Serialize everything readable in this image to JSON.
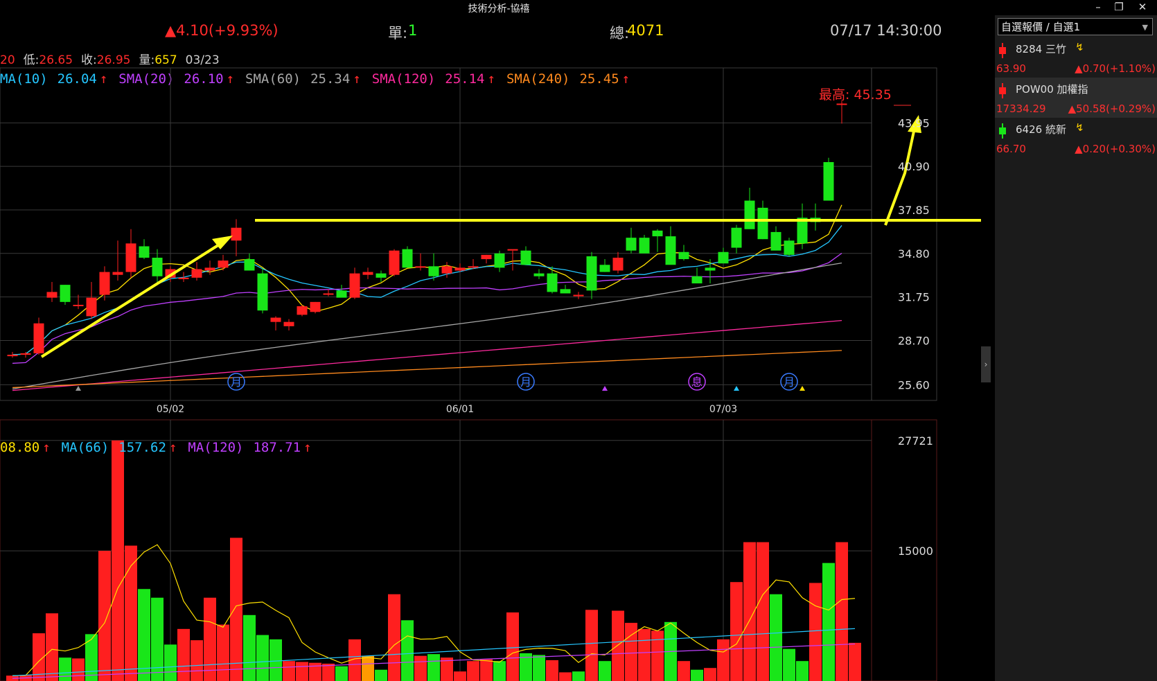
{
  "window": {
    "title": "技術分析-協禧",
    "minimize_icon": "minimize-icon",
    "restore_icon": "restore-icon",
    "close_icon": "close-icon"
  },
  "quote": {
    "change": "▲4.10(+9.93%)",
    "single_label": "單:",
    "single_value": "1",
    "total_label": "總:",
    "total_value": "4071",
    "datetime": "07/17 14:30:00"
  },
  "ohlc": {
    "high_fragment": "20",
    "low_label": "低:",
    "low_value": "26.65",
    "close_label": "收:",
    "close_value": "26.95",
    "volume_label": "量:",
    "volume_value": "657",
    "date": "03/23"
  },
  "price_ma": [
    {
      "label": "MA(10)",
      "value": "26.04",
      "arrow": "↑",
      "color": "#25c6ff"
    },
    {
      "label": "SMA(20)",
      "value": "26.10",
      "arrow": "↑",
      "color": "#c040ff"
    },
    {
      "label": "SMA(60)",
      "value": "25.34",
      "arrow": "↑",
      "color": "#a8a8a8"
    },
    {
      "label": "SMA(120)",
      "value": "25.14",
      "arrow": "↑",
      "color": "#ff2a9e"
    },
    {
      "label": "SMA(240)",
      "value": "25.45",
      "arrow": "↑",
      "color": "#ff8a1e"
    }
  ],
  "volume_ma": [
    {
      "label": "08.80",
      "value": "",
      "arrow": "↑",
      "color": "#ffe000"
    },
    {
      "label": "MA(66)",
      "value": "157.62",
      "arrow": "↑",
      "color": "#25c6ff"
    },
    {
      "label": "MA(120)",
      "value": "187.71",
      "arrow": "↑",
      "color": "#c040ff"
    }
  ],
  "chart_data": {
    "type": "candlestick",
    "price_axis": {
      "ticks": [
        "43.95",
        "40.90",
        "37.85",
        "34.80",
        "31.75",
        "28.70",
        "25.60"
      ],
      "range": [
        24.5,
        47.8
      ]
    },
    "date_ticks": [
      "05/02",
      "06/01",
      "07/03"
    ],
    "max_label": "最高: 45.35",
    "event_markers": [
      "月",
      "月",
      "息",
      "月"
    ],
    "candles": [
      [
        27.6,
        27.9,
        27.5,
        27.7
      ],
      [
        27.7,
        27.9,
        27.5,
        27.8
      ],
      [
        27.8,
        30.3,
        27.7,
        29.9
      ],
      [
        31.7,
        32.8,
        31.4,
        32.1
      ],
      [
        32.6,
        32.6,
        31.2,
        31.4
      ],
      [
        31.2,
        31.9,
        30.9,
        31.2
      ],
      [
        30.4,
        32.8,
        30.2,
        31.7
      ],
      [
        31.9,
        33.9,
        31.5,
        33.5
      ],
      [
        33.3,
        35.7,
        32.9,
        33.5
      ],
      [
        33.5,
        36.5,
        33.1,
        35.5
      ],
      [
        35.3,
        35.8,
        34.4,
        34.5
      ],
      [
        34.5,
        35.1,
        32.8,
        33.2
      ],
      [
        33.1,
        33.9,
        32.8,
        33.7
      ],
      [
        33.0,
        33.5,
        32.8,
        33.1
      ],
      [
        33.1,
        34.2,
        32.9,
        33.7
      ],
      [
        33.6,
        34.3,
        33.3,
        33.8
      ],
      [
        33.8,
        34.7,
        33.6,
        34.3
      ],
      [
        35.7,
        37.2,
        34.6,
        36.6
      ],
      [
        34.4,
        34.8,
        33.9,
        33.6
      ],
      [
        33.4,
        33.8,
        30.6,
        30.8
      ],
      [
        30.0,
        30.4,
        29.4,
        30.3
      ],
      [
        29.7,
        30.2,
        29.4,
        30.0
      ],
      [
        30.5,
        31.2,
        30.4,
        31.1
      ],
      [
        30.7,
        31.4,
        30.6,
        31.4
      ],
      [
        32.0,
        32.3,
        31.8,
        32.0
      ],
      [
        32.2,
        32.6,
        31.9,
        31.7
      ],
      [
        31.7,
        33.8,
        31.6,
        33.4
      ],
      [
        33.3,
        33.8,
        33.0,
        33.5
      ],
      [
        33.4,
        33.6,
        32.8,
        33.1
      ],
      [
        33.3,
        35.1,
        33.2,
        35.0
      ],
      [
        35.1,
        35.3,
        33.8,
        33.8
      ],
      [
        33.8,
        34.8,
        33.6,
        33.9
      ],
      [
        33.9,
        34.8,
        32.9,
        33.2
      ],
      [
        33.4,
        34.2,
        33.1,
        33.9
      ],
      [
        33.6,
        34.1,
        33.5,
        33.8
      ],
      [
        33.9,
        34.4,
        33.7,
        33.9
      ],
      [
        34.4,
        34.7,
        34.1,
        34.7
      ],
      [
        34.8,
        35.0,
        33.5,
        33.8
      ],
      [
        35.0,
        35.0,
        33.6,
        35.1
      ],
      [
        35.0,
        35.3,
        34.0,
        34.0
      ],
      [
        33.4,
        33.7,
        33.0,
        33.2
      ],
      [
        33.4,
        33.9,
        32.0,
        32.1
      ],
      [
        32.3,
        32.6,
        32.0,
        32.0
      ],
      [
        31.8,
        32.1,
        31.6,
        31.9
      ],
      [
        34.6,
        34.9,
        31.6,
        32.2
      ],
      [
        34.0,
        34.4,
        33.5,
        33.5
      ],
      [
        33.6,
        34.9,
        33.4,
        34.5
      ],
      [
        35.9,
        36.6,
        34.8,
        35.0
      ],
      [
        35.9,
        36.1,
        34.9,
        34.8
      ],
      [
        36.4,
        36.5,
        34.9,
        36.0
      ],
      [
        36.0,
        36.7,
        34.4,
        34.0
      ],
      [
        34.9,
        35.4,
        34.3,
        34.4
      ],
      [
        33.2,
        33.8,
        33.0,
        32.7
      ],
      [
        33.8,
        34.4,
        32.7,
        33.6
      ],
      [
        34.9,
        35.2,
        34.1,
        34.1
      ],
      [
        36.6,
        36.8,
        34.8,
        35.2
      ],
      [
        38.5,
        39.4,
        36.6,
        36.5
      ],
      [
        38.0,
        38.5,
        35.8,
        35.8
      ],
      [
        36.3,
        36.7,
        35.3,
        35.0
      ],
      [
        35.7,
        35.9,
        34.6,
        34.7
      ],
      [
        37.3,
        38.3,
        35.1,
        35.5
      ],
      [
        37.3,
        38.3,
        36.4,
        37.0
      ],
      [
        41.2,
        41.5,
        38.6,
        38.5
      ],
      [
        45.3,
        45.5,
        43.9,
        45.3
      ]
    ],
    "volume_axis": {
      "ticks": [
        "27721",
        "15000"
      ],
      "range": [
        0,
        28500
      ]
    },
    "volume": [
      [
        620,
        "r"
      ],
      [
        680,
        "r"
      ],
      [
        5500,
        "r"
      ],
      [
        7800,
        "r"
      ],
      [
        2700,
        "g"
      ],
      [
        2600,
        "r"
      ],
      [
        5400,
        "g"
      ],
      [
        15000,
        "r"
      ],
      [
        27721,
        "r"
      ],
      [
        15600,
        "r"
      ],
      [
        10600,
        "g"
      ],
      [
        9600,
        "g"
      ],
      [
        4200,
        "g"
      ],
      [
        6000,
        "r"
      ],
      [
        4700,
        "r"
      ],
      [
        9600,
        "r"
      ],
      [
        6500,
        "r"
      ],
      [
        16500,
        "r"
      ],
      [
        7600,
        "g"
      ],
      [
        5300,
        "g"
      ],
      [
        4800,
        "g"
      ],
      [
        2300,
        "r"
      ],
      [
        2200,
        "r"
      ],
      [
        2100,
        "r"
      ],
      [
        2000,
        "r"
      ],
      [
        1700,
        "g"
      ],
      [
        4800,
        "r"
      ],
      [
        2900,
        "o"
      ],
      [
        1300,
        "g"
      ],
      [
        10000,
        "r"
      ],
      [
        7000,
        "g"
      ],
      [
        2900,
        "r"
      ],
      [
        3100,
        "g"
      ],
      [
        2700,
        "r"
      ],
      [
        1100,
        "r"
      ],
      [
        2300,
        "r"
      ],
      [
        2500,
        "r"
      ],
      [
        2300,
        "g"
      ],
      [
        7900,
        "r"
      ],
      [
        3200,
        "g"
      ],
      [
        3000,
        "g"
      ],
      [
        2400,
        "r"
      ],
      [
        1000,
        "r"
      ],
      [
        1100,
        "g"
      ],
      [
        8200,
        "r"
      ],
      [
        2300,
        "g"
      ],
      [
        8100,
        "r"
      ],
      [
        6700,
        "r"
      ],
      [
        6000,
        "r"
      ],
      [
        5800,
        "r"
      ],
      [
        6800,
        "g"
      ],
      [
        2300,
        "r"
      ],
      [
        1300,
        "g"
      ],
      [
        1500,
        "r"
      ],
      [
        4800,
        "r"
      ],
      [
        11400,
        "r"
      ],
      [
        16000,
        "r"
      ],
      [
        16000,
        "r"
      ],
      [
        10000,
        "g"
      ],
      [
        3700,
        "g"
      ],
      [
        2300,
        "g"
      ],
      [
        11300,
        "r"
      ],
      [
        13600,
        "g"
      ],
      [
        16000,
        "r"
      ],
      [
        4400,
        "r"
      ]
    ]
  },
  "watchlist": {
    "selector": "自選報價 / 自選1",
    "items": [
      {
        "name": "8284 三竹",
        "bolt": "↯",
        "price": "63.90",
        "change": "▲0.70(+1.10%)",
        "up": true
      },
      {
        "name": "POW00 加權指",
        "bolt": "",
        "price": "17334.29",
        "change": "▲50.58(+0.29%)",
        "up": true
      },
      {
        "name": "6426 統新",
        "bolt": "↯",
        "price": "66.70",
        "change": "▲0.20(+0.30%)",
        "up": false
      }
    ]
  },
  "colors": {
    "up": "#ff1f1f",
    "down": "#19e619",
    "grid": "#3a3a3a",
    "annotation": "#ffff1a"
  }
}
